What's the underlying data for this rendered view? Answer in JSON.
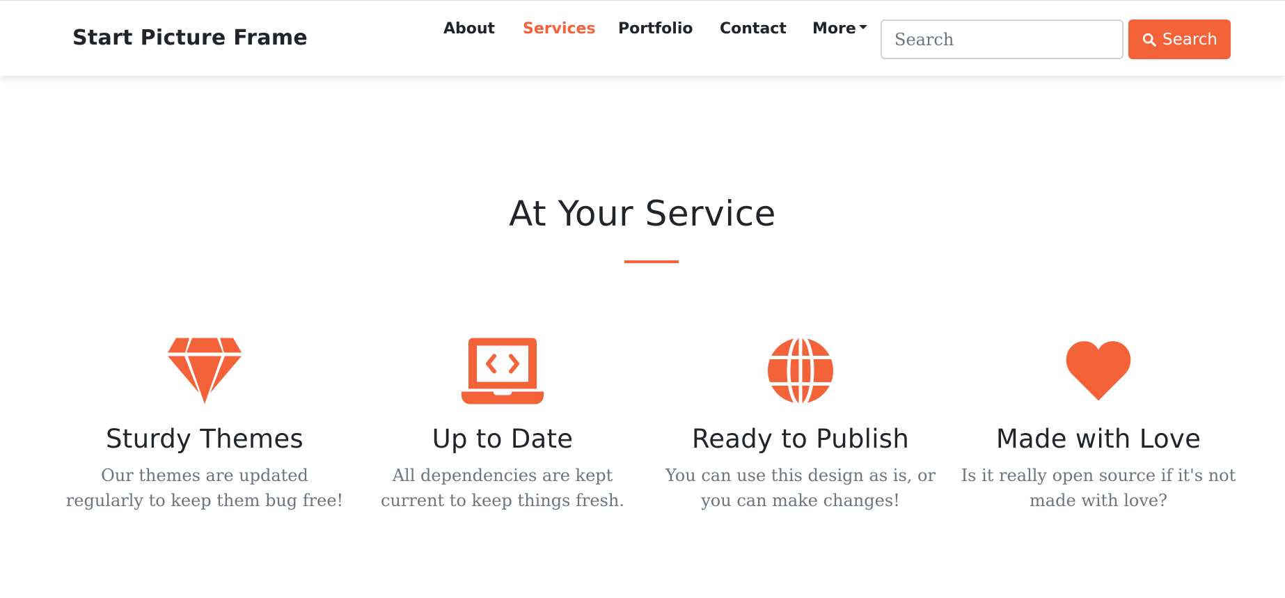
{
  "navbar": {
    "brand": "Start Picture Frame",
    "links": [
      {
        "label": "About",
        "active": false
      },
      {
        "label": "Services",
        "active": true
      },
      {
        "label": "Portfolio",
        "active": false
      },
      {
        "label": "Contact",
        "active": false
      },
      {
        "label": "More",
        "active": false,
        "dropdown": true
      }
    ],
    "search": {
      "placeholder": "Search",
      "value": "",
      "button_label": "Search",
      "button_icon": "search-icon"
    }
  },
  "section": {
    "title": "At Your Service"
  },
  "features": [
    {
      "icon": "gem-icon",
      "title": "Sturdy Themes",
      "text": "Our themes are updated regularly to keep them bug free!"
    },
    {
      "icon": "laptop-code-icon",
      "title": "Up to Date",
      "text": "All dependencies are kept current to keep things fresh."
    },
    {
      "icon": "globe-icon",
      "title": "Ready to Publish",
      "text": "You can use this design as is, or you can make changes!"
    },
    {
      "icon": "heart-icon",
      "title": "Made with Love",
      "text": "Is it really open source if it's not made with love?"
    }
  ],
  "colors": {
    "accent": "#f4623a",
    "text_dark": "#212529",
    "text_muted": "#6c757d"
  }
}
